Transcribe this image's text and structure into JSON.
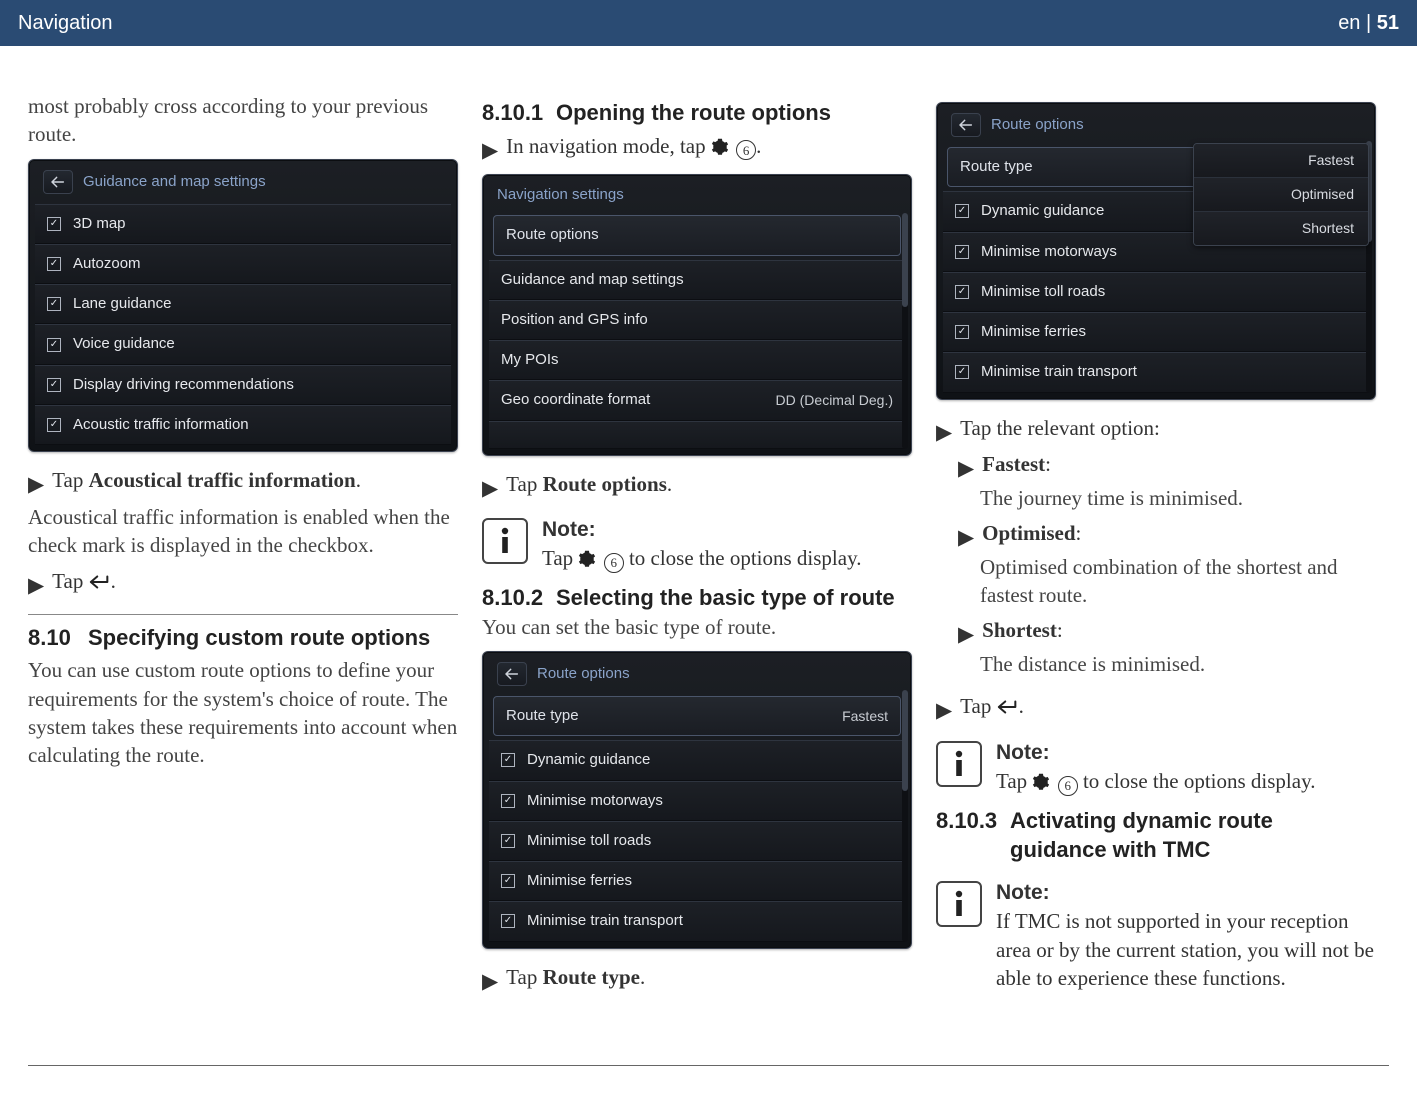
{
  "header": {
    "left": "Navigation",
    "right_lang": "en",
    "right_sep": " | ",
    "right_page": "51"
  },
  "col1": {
    "intro": "most probably cross according to your previous route.",
    "panel": {
      "title": "Guidance and map settings",
      "items": [
        {
          "label": "3D map",
          "checked": true
        },
        {
          "label": "Autozoom",
          "checked": true
        },
        {
          "label": "Lane guidance",
          "checked": true
        },
        {
          "label": "Voice guidance",
          "checked": true
        },
        {
          "label": "Display driving recommendations",
          "checked": true
        },
        {
          "label": "Acoustic traffic information",
          "checked": true
        }
      ]
    },
    "step1_pre": "Tap ",
    "step1_bold": "Acoustical traffic information",
    "step1_post": ".",
    "para": "Acoustical traffic information is enabled when the check mark is displayed in the checkbox.",
    "step2_pre": "Tap ",
    "step2_post": ".",
    "sec_num": "8.10",
    "sec_title": "Specifying custom route options",
    "sec_body": "You can use custom route options to define your requirements for the system's choice of route. The system takes these requirements into account when calculating the route."
  },
  "col2": {
    "h1_num": "8.10.1",
    "h1_title": "Opening the route options",
    "h1_step_pre": "In navigation mode, tap ",
    "h1_step_post": ".",
    "panel1": {
      "title": "Navigation settings",
      "header_item": "Route options",
      "items": [
        {
          "label": "Guidance and map settings"
        },
        {
          "label": "Position and GPS info"
        },
        {
          "label": "My POIs"
        },
        {
          "label": "Geo coordinate format",
          "right": "DD (Decimal Deg.)"
        }
      ]
    },
    "step_ro_pre": "Tap ",
    "step_ro_bold": "Route options",
    "step_ro_post": ".",
    "note1_hd": "Note:",
    "note1_pre": "Tap ",
    "note1_post": " to close the options display.",
    "h2_num": "8.10.2",
    "h2_title": "Selecting the basic type of route",
    "h2_intro": "You can set the basic type of route.",
    "panel2": {
      "title": "Route options",
      "header_item_left": "Route type",
      "header_item_right": "Fastest",
      "items": [
        {
          "label": "Dynamic guidance",
          "checked": true
        },
        {
          "label": "Minimise motorways",
          "checked": true
        },
        {
          "label": "Minimise toll roads",
          "checked": true
        },
        {
          "label": "Minimise ferries",
          "checked": true
        },
        {
          "label": "Minimise train transport",
          "checked": true
        }
      ]
    },
    "step_rt_pre": "Tap ",
    "step_rt_bold": "Route type",
    "step_rt_post": "."
  },
  "col3": {
    "panel": {
      "title": "Route options",
      "header_item_left": "Route type",
      "header_item_right": "Fastest",
      "items": [
        {
          "label": "Dynamic guidance",
          "checked": true
        },
        {
          "label": "Minimise motorways",
          "checked": true
        },
        {
          "label": "Minimise toll roads",
          "checked": true
        },
        {
          "label": "Minimise ferries",
          "checked": true
        },
        {
          "label": "Minimise train transport",
          "checked": true
        }
      ],
      "dropdown": [
        "Fastest",
        "Optimised",
        "Shortest"
      ]
    },
    "lead": "Tap the relevant option:",
    "opts": [
      {
        "name": "Fastest",
        "desc": "The journey time is minimised."
      },
      {
        "name": "Optimised",
        "desc": "Optimised combination of the shortest and fastest route."
      },
      {
        "name": "Shortest",
        "desc": "The distance is minimised."
      }
    ],
    "step_back_pre": "Tap ",
    "step_back_post": ".",
    "note_hd": "Note:",
    "note_pre": "Tap ",
    "note_post": " to close the options display.",
    "h3_num": "8.10.3",
    "h3_title": "Activating dynamic route guidance with TMC",
    "note2_hd": "Note:",
    "note2_body": "If TMC is not supported in your reception area or by the current station, you will not be able to experience these functions."
  },
  "circ_num": "6"
}
